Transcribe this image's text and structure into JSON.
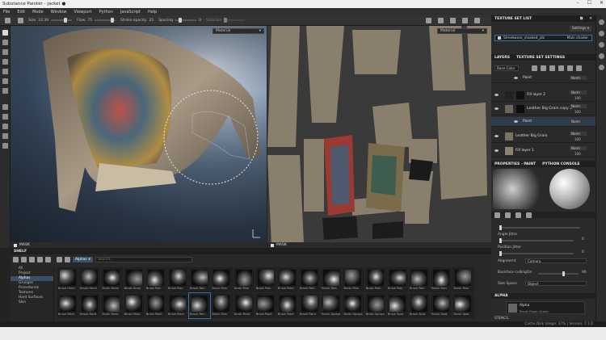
{
  "window": {
    "title": "Substance Painter - jacket ●"
  },
  "menu": [
    "File",
    "Edit",
    "Mode",
    "Window",
    "Viewport",
    "Python",
    "JavaScript",
    "Help"
  ],
  "toolbar": {
    "size_label": "Size",
    "size_value": "33.39",
    "flow_label": "Flow",
    "flow_value": "75",
    "stroke_opacity_label": "Stroke opacity",
    "stroke_opacity_value": "25",
    "spacing_label": "Spacing",
    "spacing_value": "0",
    "stabilize_label": "Stabilize"
  },
  "viewport3d": {
    "mode_select": "Material",
    "footer_label": "MASK"
  },
  "viewport2d": {
    "mode_select": "Material",
    "footer_label": "MASK"
  },
  "texture_set_list": {
    "title": "TEXTURE SET LIST",
    "settings_button": "Settings ▾",
    "item_name": "Streetwear_masked_jdz",
    "shader": "Main shader"
  },
  "layers": {
    "tabs": [
      "LAYERS",
      "TEXTURE SET SETTINGS"
    ],
    "channel_select": "Base Color",
    "rows": [
      {
        "name": "Paint",
        "blend": "Norm",
        "opacity": "100"
      },
      {
        "name": "Fill layer 2",
        "blend": "Norm",
        "opacity": "100"
      },
      {
        "name": "Leather Big Grain copy 1",
        "blend": "Norm",
        "opacity": "100"
      },
      {
        "name": "Paint",
        "blend": "Norm",
        "opacity": "100"
      },
      {
        "name": "Leather Big Grain",
        "blend": "Norm",
        "opacity": "100"
      },
      {
        "name": "Fill layer 1",
        "blend": "Norm",
        "opacity": "100"
      }
    ]
  },
  "properties": {
    "tabs": [
      "PROPERTIES - PAINT",
      "PYTHON CONSOLE"
    ],
    "angle_jitter_label": "Angle Jitter",
    "angle_jitter_value": "0",
    "position_jitter_label": "Position Jitter",
    "position_jitter_value": "0",
    "alignment_label": "Alignment",
    "alignment_value": "Camera",
    "backface_label": "Backface culling",
    "backface_value": "On",
    "backface_num": "90",
    "size_space_label": "Size Space",
    "size_space_value": "Object",
    "alpha_section": "ALPHA",
    "alpha_name": "Alpha",
    "alpha_sub": "Brush Paper Grains",
    "stencil_section": "STENCIL"
  },
  "shelf": {
    "title": "SHELF",
    "filter_chip": "Alphas",
    "search_placeholder": "Search...",
    "categories": [
      "All",
      "Project",
      "Alphas",
      "Grunges",
      "Procedurals",
      "Textures",
      "Hard Surfaces",
      "Skin"
    ],
    "selected_category": "Alphas",
    "items": [
      "Brush Hmm",
      "Brush Hmm",
      "Brush Hmm",
      "Brush Hmm",
      "Brush Pain",
      "Brush Pain",
      "Brush Pain",
      "Brush Pain",
      "Brush Pain",
      "Brush Pain",
      "Brush Paint",
      "Brush Pain",
      "Brush Pain",
      "Brush Pain",
      "Brush Pain",
      "Brush Pain",
      "Brush Pain",
      "Brush Pain",
      "Brush Pain",
      "Brush Paint",
      "Brush Paint",
      "Brush Paint",
      "Brush Paint",
      "Brush Paint",
      "Brush Paint",
      "Brush Pain",
      "Brush Pain",
      "Brush Paint",
      "Brush Paint",
      "Brush Paint",
      "Brush Paint",
      "Brush Sprays",
      "Brush Sprays",
      "Brush Sprays",
      "Brush Spot",
      "Brush Spot",
      "Brush Spot",
      "Brush Spot"
    ]
  },
  "status": {
    "text": "Cache Disk Usage: 37% | Version: 7.1.0"
  }
}
